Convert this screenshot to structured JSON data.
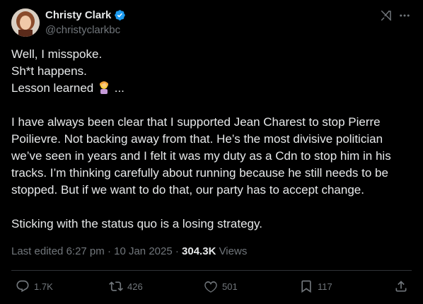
{
  "author": {
    "display_name": "Christy Clark",
    "handle": "@christyclarkbc",
    "verified_color": "#1d9bf0"
  },
  "tweet": {
    "lines_1": [
      "Well, I misspoke.",
      "Sh*t happens.",
      "Lesson learned"
    ],
    "ellipsis": "...",
    "emoji_icon": "person-facepalming-emoji",
    "paragraph_2": "I have always been clear that I supported Jean Charest to stop Pierre Poilievre.  Not backing away from that. He’s the most divisive politician we’ve seen in years and I felt it was my duty as a Cdn to stop him in his tracks. I’m thinking carefully about running because he still needs to be stopped. But if we want to do that, our party has to accept change.",
    "paragraph_3": "Sticking with the status quo is a losing strategy."
  },
  "meta": {
    "edited_prefix": "Last edited",
    "time": "6:27 pm",
    "separator": "·",
    "date": "10 Jan 2025",
    "views_count": "304.3K",
    "views_label": "Views"
  },
  "actions": {
    "replies": "1.7K",
    "reposts": "426",
    "likes": "501",
    "bookmarks": "117"
  },
  "colors": {
    "background": "#000000",
    "text": "#e7e9ea",
    "secondary": "#71767b",
    "divider": "#2f3336"
  }
}
